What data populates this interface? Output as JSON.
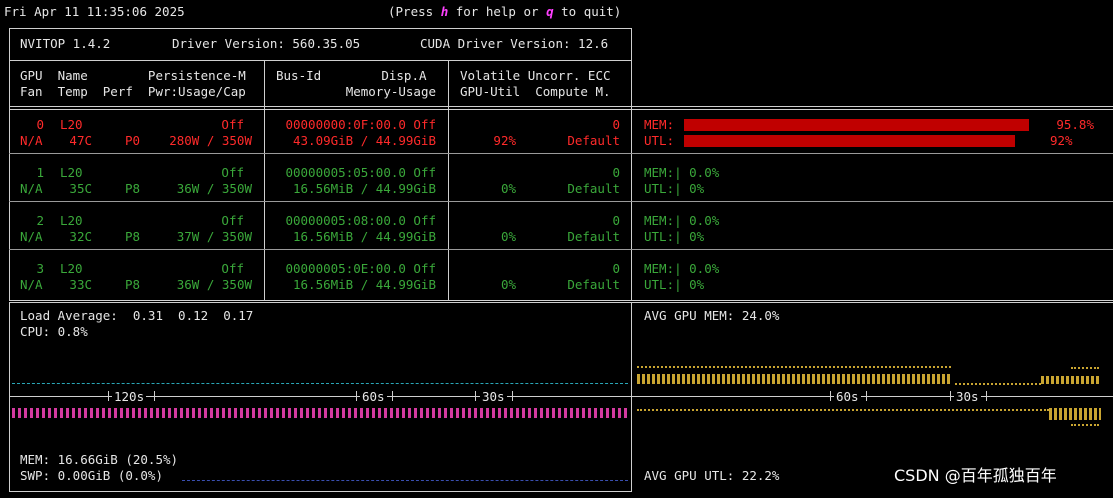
{
  "topbar": {
    "datetime": "Fri Apr 11 11:35:06 2025",
    "help_prefix": "(Press ",
    "help_key": "h",
    "help_mid": " for help or ",
    "quit_key": "q",
    "help_suffix": " to quit)"
  },
  "header": {
    "version": "NVITOP 1.4.2",
    "driver": "Driver Version: 560.35.05",
    "cuda": "CUDA Driver Version: 12.6",
    "col1_l1": "GPU  Name        Persistence-M",
    "col1_l2": "Fan  Temp  Perf  Pwr:Usage/Cap",
    "col2_l1": "Bus-Id        Disp.A",
    "col2_l2": "Memory-Usage",
    "col3_l1": "Volatile Uncorr. ECC",
    "col3_l2": "GPU-Util  Compute M."
  },
  "gpus": [
    {
      "id": "0",
      "name": "L20",
      "pers": "Off",
      "fan": "N/A",
      "temp": "47C",
      "perf": "P0",
      "pwr": "280W / 350W",
      "bus": "00000000:0F:00.0 Off",
      "mem": "43.09GiB / 44.99GiB",
      "ecc": "0",
      "util": "92%",
      "compute": "Default",
      "mem_label": "MEM:",
      "mem_pct": "95.8%",
      "mem_frac": 0.958,
      "util_label": "UTL:",
      "util_pct": "92%",
      "util_frac": 0.92,
      "color": "#ff2a2a"
    },
    {
      "id": "1",
      "name": "L20",
      "pers": "Off",
      "fan": "N/A",
      "temp": "35C",
      "perf": "P8",
      "pwr": "36W / 350W",
      "bus": "00000005:05:00.0 Off",
      "mem": "16.56MiB / 44.99GiB",
      "ecc": "0",
      "util": "0%",
      "compute": "Default",
      "mem_label": "MEM:| 0.0%",
      "util_label": "UTL:| 0%",
      "color": "#3aa83a"
    },
    {
      "id": "2",
      "name": "L20",
      "pers": "Off",
      "fan": "N/A",
      "temp": "32C",
      "perf": "P8",
      "pwr": "37W / 350W",
      "bus": "00000005:08:00.0 Off",
      "mem": "16.56MiB / 44.99GiB",
      "ecc": "0",
      "util": "0%",
      "compute": "Default",
      "mem_label": "MEM:| 0.0%",
      "util_label": "UTL:| 0%",
      "color": "#3aa83a"
    },
    {
      "id": "3",
      "name": "L20",
      "pers": "Off",
      "fan": "N/A",
      "temp": "33C",
      "perf": "P8",
      "pwr": "36W / 350W",
      "bus": "00000005:0E:00.0 Off",
      "mem": "16.56MiB / 44.99GiB",
      "ecc": "0",
      "util": "0%",
      "compute": "Default",
      "mem_label": "MEM:| 0.0%",
      "util_label": "UTL:| 0%",
      "color": "#3aa83a"
    }
  ],
  "host": {
    "load": "Load Average:  0.31  0.12  0.17",
    "cpu": "CPU: 0.8%",
    "mem": "MEM: 16.66GiB (20.5%)",
    "swp": "SWP: 0.00GiB (0.0%)",
    "t120": "120s",
    "t60": "60s",
    "t30": "30s"
  },
  "gpu_graph": {
    "avg_mem": "AVG GPU MEM: 24.0%",
    "avg_util": "AVG GPU UTL: 22.2%",
    "t60": "60s",
    "t30": "30s"
  },
  "watermark": "CSDN @百年孤独百年"
}
